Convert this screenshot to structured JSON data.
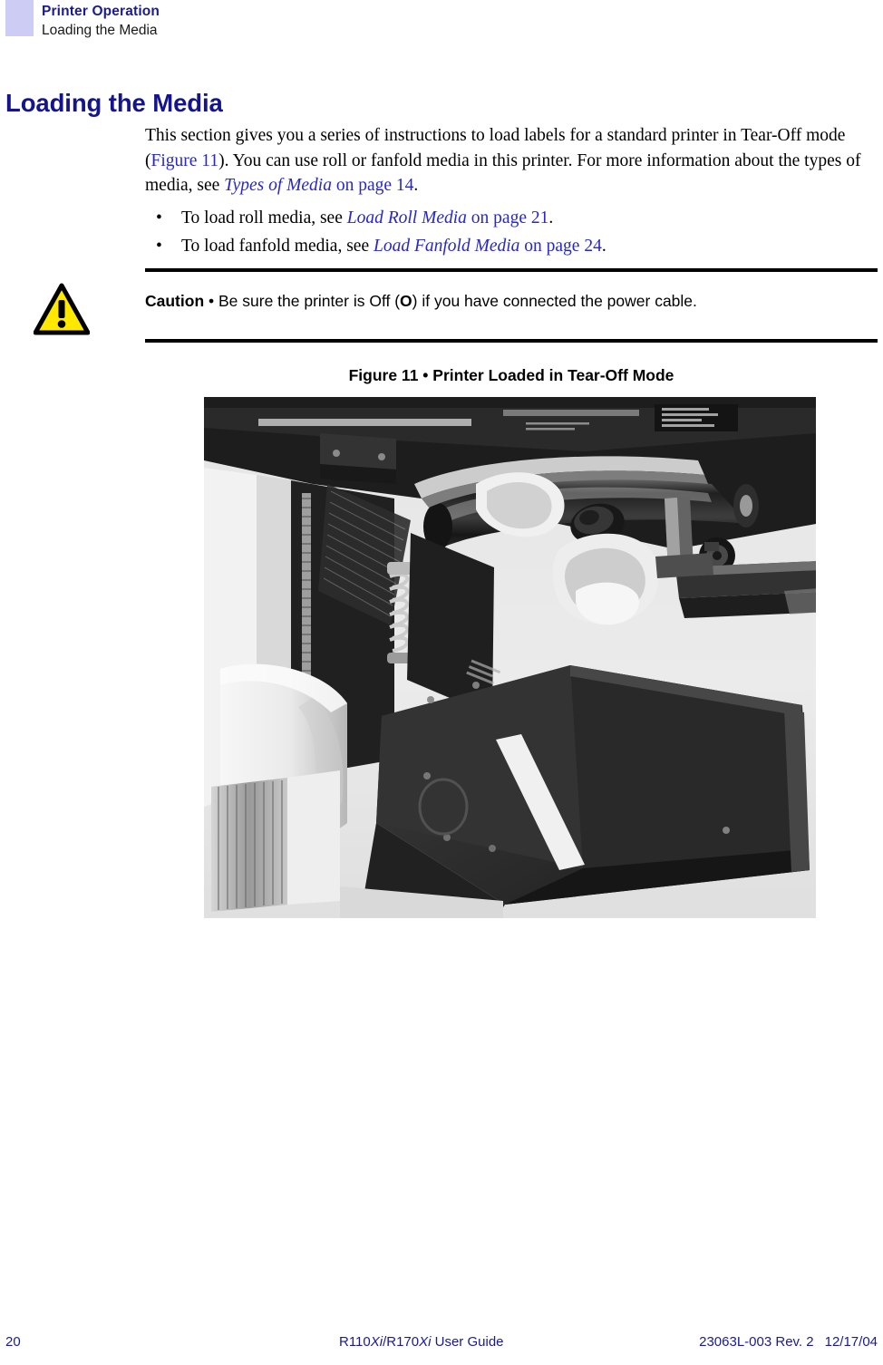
{
  "header": {
    "chapter": "Printer Operation",
    "section": "Loading the Media",
    "swatch_color": "#ccccf5",
    "chapter_color": "#1a1a96"
  },
  "heading": {
    "title": "Loading the Media",
    "color": "#14148c"
  },
  "body": {
    "paragraph": {
      "part1": "This section gives you a series of instructions to load labels for a standard printer in Tear-Off mode (",
      "xref_figure": "Figure 11",
      "part2": "). You can use roll or fanfold media in this printer. For more information about the types of media, see ",
      "xref_types": "Types of Media",
      "part3": " on page 14",
      "part4": "."
    },
    "bullets": [
      {
        "marker": "•",
        "text_before": "To load roll media, see ",
        "xref_title": "Load Roll Media",
        "xref_page": " on page 21",
        "text_after": "."
      },
      {
        "marker": "•",
        "text_before": "To load fanfold media, see ",
        "xref_title": "Load Fanfold Media",
        "xref_page": " on page 24",
        "text_after": "."
      }
    ],
    "xref_color": "#2727cc"
  },
  "caution": {
    "icon_name": "warning-triangle-icon",
    "icon_fill": "#ffe800",
    "icon_stroke": "#000000",
    "label": "Caution",
    "separator": " • ",
    "text_before": "Be sure the printer is Off (",
    "off_symbol": "O",
    "text_after": ") if you have connected the power cable."
  },
  "figure": {
    "caption_number": "Figure 11",
    "caption_separator": " • ",
    "caption_title": "Printer Loaded in Tear-Off Mode",
    "caption_full": "Figure 11 • Printer Loaded in Tear-Off Mode",
    "alt": "Black-and-white photograph of a printer with media loaded in Tear-Off mode, showing the printhead assembly, platen roller, media roll, and tear-off bar."
  },
  "footer": {
    "page_number": "20",
    "guide_prefix": "R110",
    "guide_xi_1": "Xi",
    "guide_mid": "/R170",
    "guide_xi_2": "Xi",
    "guide_suffix": " User Guide",
    "part_number": "23063L-003 Rev. 2",
    "date": "12/17/04",
    "color": "#1a1a96"
  }
}
